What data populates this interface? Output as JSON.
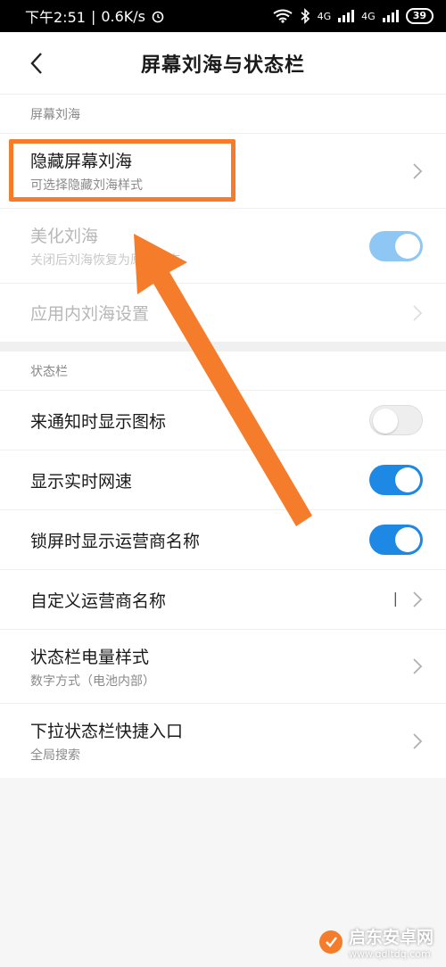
{
  "status_bar": {
    "time": "下午2:51",
    "speed": "0.6K/s",
    "network1": "4G",
    "network2": "4G",
    "battery": "39"
  },
  "header": {
    "title": "屏幕刘海与状态栏"
  },
  "notch_section": {
    "title": "屏幕刘海",
    "hide_notch": {
      "label": "隐藏屏幕刘海",
      "sub": "可选择隐藏刘海样式"
    },
    "beautify_notch": {
      "label": "美化刘海",
      "sub": "关闭后刘海恢复为原始形态",
      "state": "on-disabled"
    },
    "app_notch": {
      "label": "应用内刘海设置"
    }
  },
  "statusbar_section": {
    "title": "状态栏",
    "notify_icon": {
      "label": "来通知时显示图标",
      "state": "off"
    },
    "net_speed": {
      "label": "显示实时网速",
      "state": "on"
    },
    "carrier_lock": {
      "label": "锁屏时显示运营商名称",
      "state": "on"
    },
    "custom_carrier": {
      "label": "自定义运营商名称",
      "value": "|"
    },
    "battery_style": {
      "label": "状态栏电量样式",
      "sub": "数字方式（电池内部）"
    },
    "pulldown_shortcut": {
      "label": "下拉状态栏快捷入口",
      "sub": "全局搜索"
    }
  },
  "watermark": {
    "text": "启东安卓网",
    "url": "www.qdltdq.com"
  },
  "colors": {
    "accent": "#1e88e5",
    "highlight": "#f57c2a"
  }
}
